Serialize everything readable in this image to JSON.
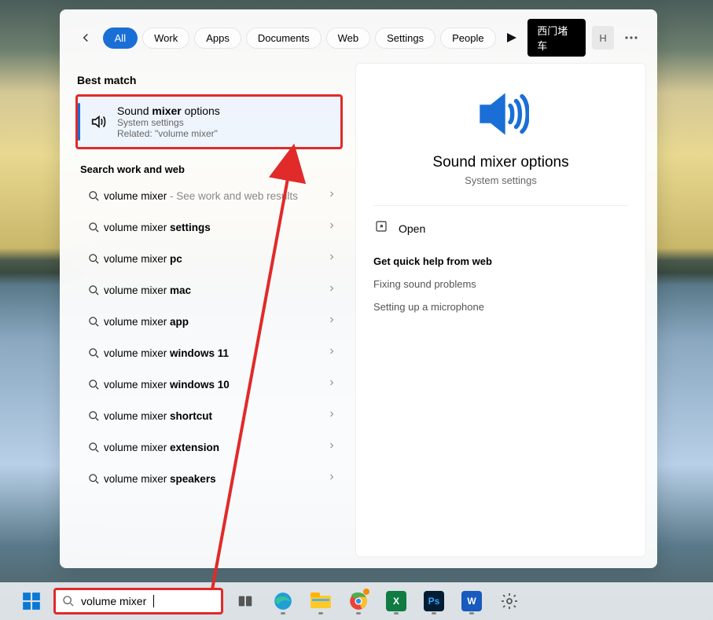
{
  "topbar": {
    "tabs": [
      "All",
      "Work",
      "Apps",
      "Documents",
      "Web",
      "Settings",
      "People"
    ],
    "active_tab_index": 0,
    "right_pill": "西门堵车",
    "avatar_initial": "H"
  },
  "bestmatch": {
    "section_label": "Best match",
    "title_pre": "Sound ",
    "title_bold": "mixer",
    "title_post": " options",
    "sub1": "System settings",
    "sub2": "Related: \"volume mixer\""
  },
  "search_section_label": "Search work and web",
  "results": [
    {
      "prefix": "volume mixer",
      "suffix_light": " - See work and web results",
      "bold": ""
    },
    {
      "prefix": "volume mixer ",
      "bold": "settings",
      "suffix_light": ""
    },
    {
      "prefix": "volume mixer ",
      "bold": "pc",
      "suffix_light": ""
    },
    {
      "prefix": "volume mixer ",
      "bold": "mac",
      "suffix_light": ""
    },
    {
      "prefix": "volume mixer ",
      "bold": "app",
      "suffix_light": ""
    },
    {
      "prefix": "volume mixer ",
      "bold": "windows 11",
      "suffix_light": ""
    },
    {
      "prefix": "volume mixer ",
      "bold": "windows 10",
      "suffix_light": ""
    },
    {
      "prefix": "volume mixer ",
      "bold": "shortcut",
      "suffix_light": ""
    },
    {
      "prefix": "volume mixer ",
      "bold": "extension",
      "suffix_light": ""
    },
    {
      "prefix": "volume mixer ",
      "bold": "speakers",
      "suffix_light": ""
    }
  ],
  "detail": {
    "title": "Sound mixer options",
    "subtitle": "System settings",
    "open_label": "Open",
    "quick_help_label": "Get quick help from web",
    "quick_links": [
      "Fixing sound problems",
      "Setting up a microphone"
    ]
  },
  "taskbar": {
    "search_value": "volume mixer"
  }
}
